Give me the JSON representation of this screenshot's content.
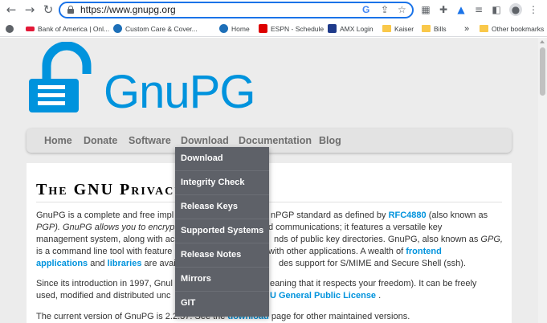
{
  "browser": {
    "url": "https://www.gnupg.org",
    "bookmarks": [
      {
        "label": "Bank of America | Onl...",
        "color": "#e31837"
      },
      {
        "label": "Custom Care & Cover...",
        "color": "#1d6fb8"
      },
      {
        "label": "Home",
        "color": "#1d6fb8"
      },
      {
        "label": "ESPN - Schedule",
        "color": "#d00"
      },
      {
        "label": "AMX Login",
        "color": "#1e3a8a"
      },
      {
        "label": "Kaiser",
        "color": "#f9c84a"
      },
      {
        "label": "Bills",
        "color": "#f9c84a"
      }
    ],
    "more_bookmarks": "»",
    "other_bookmarks": "Other bookmarks"
  },
  "site": {
    "logo_text": "GnuPG",
    "brand_color": "#0093dd",
    "nav": [
      "Home",
      "Donate",
      "Software",
      "Download",
      "Documentation",
      "Blog"
    ],
    "dropdown": [
      "Download",
      "Integrity Check",
      "Release Keys",
      "Supported Systems",
      "Release Notes",
      "Mirrors",
      "GIT"
    ],
    "heading": "The GNU Privacy",
    "p1": {
      "a": "GnuPG is a complete and free impl",
      "b": "nPGP standard as defined by",
      "link1": "RFC4880",
      "c": "(also known as",
      "d": "PGP). GnuPG allows you to encrypt",
      "e": "d communications; it features a versatile key",
      "f": "management system, along with ac",
      "g": "nds of public key directories. GnuPG, also known as",
      "h": "GPG,",
      "i": "is a command line tool with feature",
      "j": "with other applications. A wealth of",
      "link2": "frontend",
      "link3": "applications",
      "k": "and",
      "link4": "libraries",
      "l": "are avai",
      "m": "des support for S/MIME and Secure Shell (ssh)."
    },
    "p2": {
      "a": "Since its introduction in 1997, Gnul",
      "b": "eaning that it respects your freedom). It can be freely",
      "c": "used, modified and distributed unc",
      "link": "U General Public License",
      "d": "."
    },
    "p3": {
      "a": "The current version of GnuPG is 2.2.37. See the",
      "link": "download",
      "b": "page for other maintained versions."
    }
  }
}
